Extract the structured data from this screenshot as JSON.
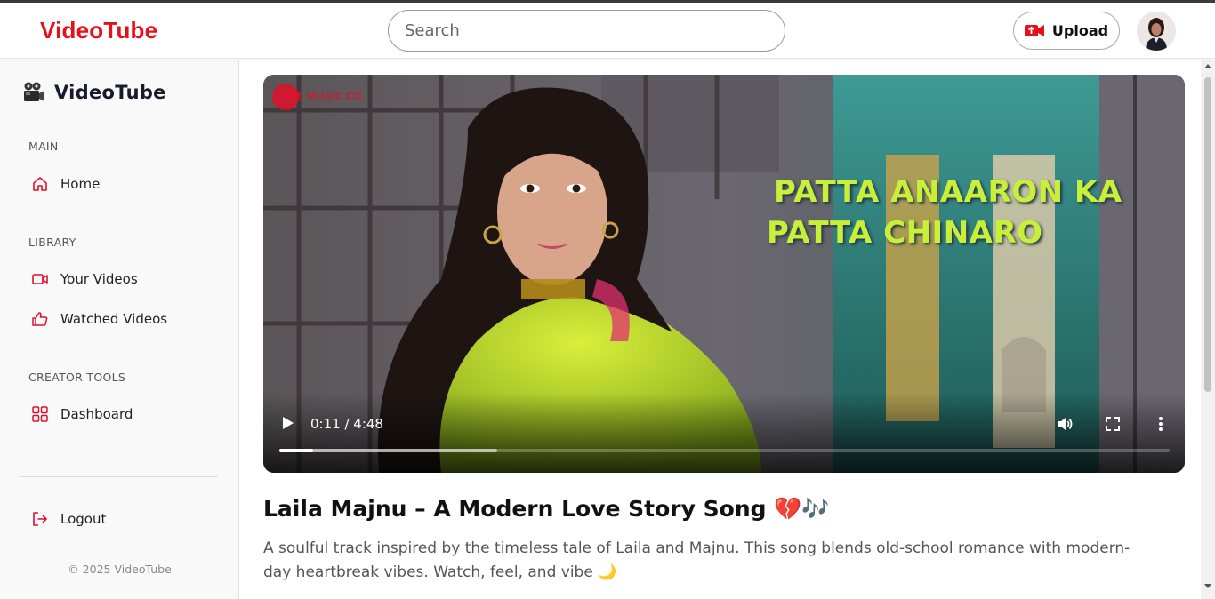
{
  "header": {
    "brand": "VideoTube",
    "search_placeholder": "Search",
    "search_value": "",
    "upload_label": "Upload",
    "upload_icon": "video-camera-icon",
    "avatar_icon": "user-avatar"
  },
  "sidebar": {
    "brand": "VideoTube",
    "brand_icon": "movie-camera-icon",
    "sections": {
      "main": {
        "title": "MAIN",
        "items": [
          {
            "label": "Home",
            "icon": "home-icon"
          }
        ]
      },
      "library": {
        "title": "LIBRARY",
        "items": [
          {
            "label": "Your Videos",
            "icon": "video-icon"
          },
          {
            "label": "Watched Videos",
            "icon": "thumbs-up-icon"
          }
        ]
      },
      "creator_tools": {
        "title": "CREATOR TOOLS",
        "items": [
          {
            "label": "Dashboard",
            "icon": "dashboard-grid-icon"
          }
        ]
      }
    },
    "logout_label": "Logout",
    "logout_icon": "logout-icon",
    "copyright": "© 2025 VideoTube"
  },
  "player": {
    "watermark": "ZEE MUSIC CO.",
    "lyric_line_1": "PATTA ANAARON KA",
    "lyric_line_2": "PATTA CHINARO",
    "time": "0:11 / 4:48",
    "current_seconds": 11,
    "duration_seconds": 288,
    "buffered_fraction": 0.245,
    "controls": [
      "play-icon",
      "volume-icon",
      "fullscreen-icon",
      "more-options-icon"
    ]
  },
  "video": {
    "title": "Laila Majnu – A Modern Love Story Song 💔🎶",
    "description": "A soulful track inspired by the timeless tale of Laila and Majnu. This song blends old-school romance with modern-day heartbreak vibes. Watch, feel, and vibe 🌙"
  },
  "colors": {
    "brand_red": "#e5101a",
    "accent_red": "#e0102a",
    "lyric_green": "#c8f03a"
  }
}
